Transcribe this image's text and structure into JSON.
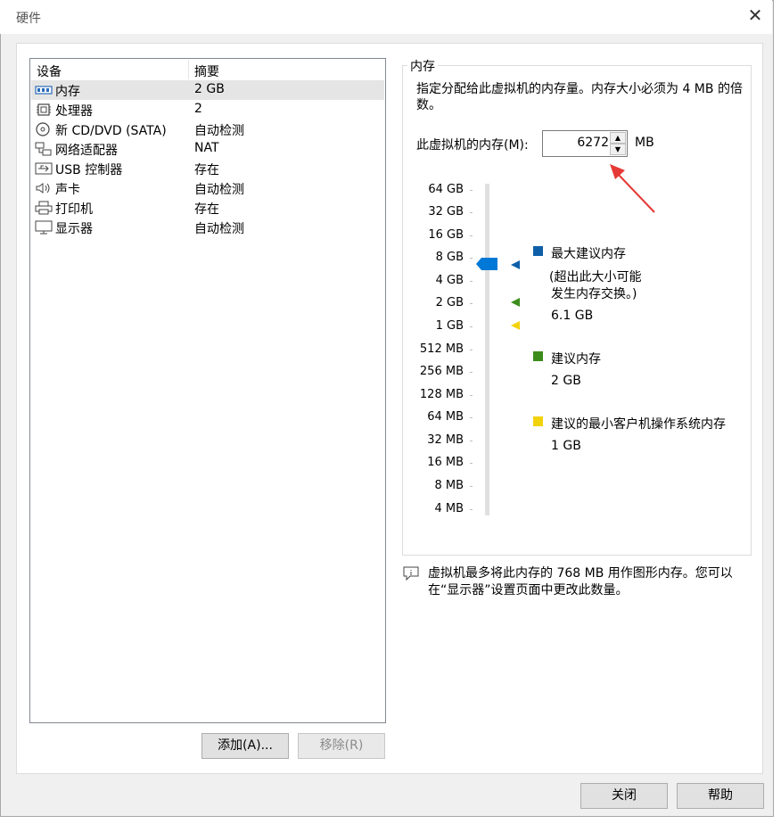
{
  "window": {
    "title": "硬件"
  },
  "device_list": {
    "headers": {
      "device": "设备",
      "summary": "摘要"
    },
    "items": [
      {
        "name": "内存",
        "summary": "2 GB",
        "icon": "memory-icon"
      },
      {
        "name": "处理器",
        "summary": "2",
        "icon": "processor-icon"
      },
      {
        "name": "新 CD/DVD (SATA)",
        "summary": "自动检测",
        "icon": "cd-dvd-icon"
      },
      {
        "name": "网络适配器",
        "summary": "NAT",
        "icon": "network-adapter-icon"
      },
      {
        "name": "USB 控制器",
        "summary": "存在",
        "icon": "usb-icon"
      },
      {
        "name": "声卡",
        "summary": "自动检测",
        "icon": "speaker-icon"
      },
      {
        "name": "打印机",
        "summary": "存在",
        "icon": "printer-icon"
      },
      {
        "name": "显示器",
        "summary": "自动检测",
        "icon": "monitor-icon"
      }
    ],
    "add_label": "添加(A)...",
    "remove_label": "移除(R)"
  },
  "memory": {
    "group_title": "内存",
    "description": "指定分配给此虚拟机的内存量。内存大小必须为 4 MB 的倍数。",
    "field_label": "此虚拟机的内存(M):",
    "value": "6272",
    "unit": "MB",
    "scale_ticks": [
      "64 GB",
      "32 GB",
      "16 GB",
      "8 GB",
      "4 GB",
      "2 GB",
      "1 GB",
      "512 MB",
      "256 MB",
      "128 MB",
      "64 MB",
      "32 MB",
      "16 MB",
      "8 MB",
      "4 MB"
    ],
    "legend": {
      "max": {
        "title": "最大建议内存",
        "note_line1": "(超出此大小可能",
        "note_line2": "发生内存交换。)",
        "value": "6.1 GB",
        "color": "#0e5fa8"
      },
      "recommended": {
        "title": "建议内存",
        "value": "2 GB",
        "color": "#3c8d1b"
      },
      "min": {
        "title": "建议的最小客户机操作系统内存",
        "value": "1 GB",
        "color": "#f2d20c"
      }
    },
    "thumb_color": "#0078d7",
    "annotation_color": "#e53935",
    "info": "虚拟机最多将此内存的 768 MB 用作图形内存。您可以在“显示器”设置页面中更改此数量。"
  },
  "footer": {
    "close_label": "关闭",
    "help_label": "帮助"
  }
}
